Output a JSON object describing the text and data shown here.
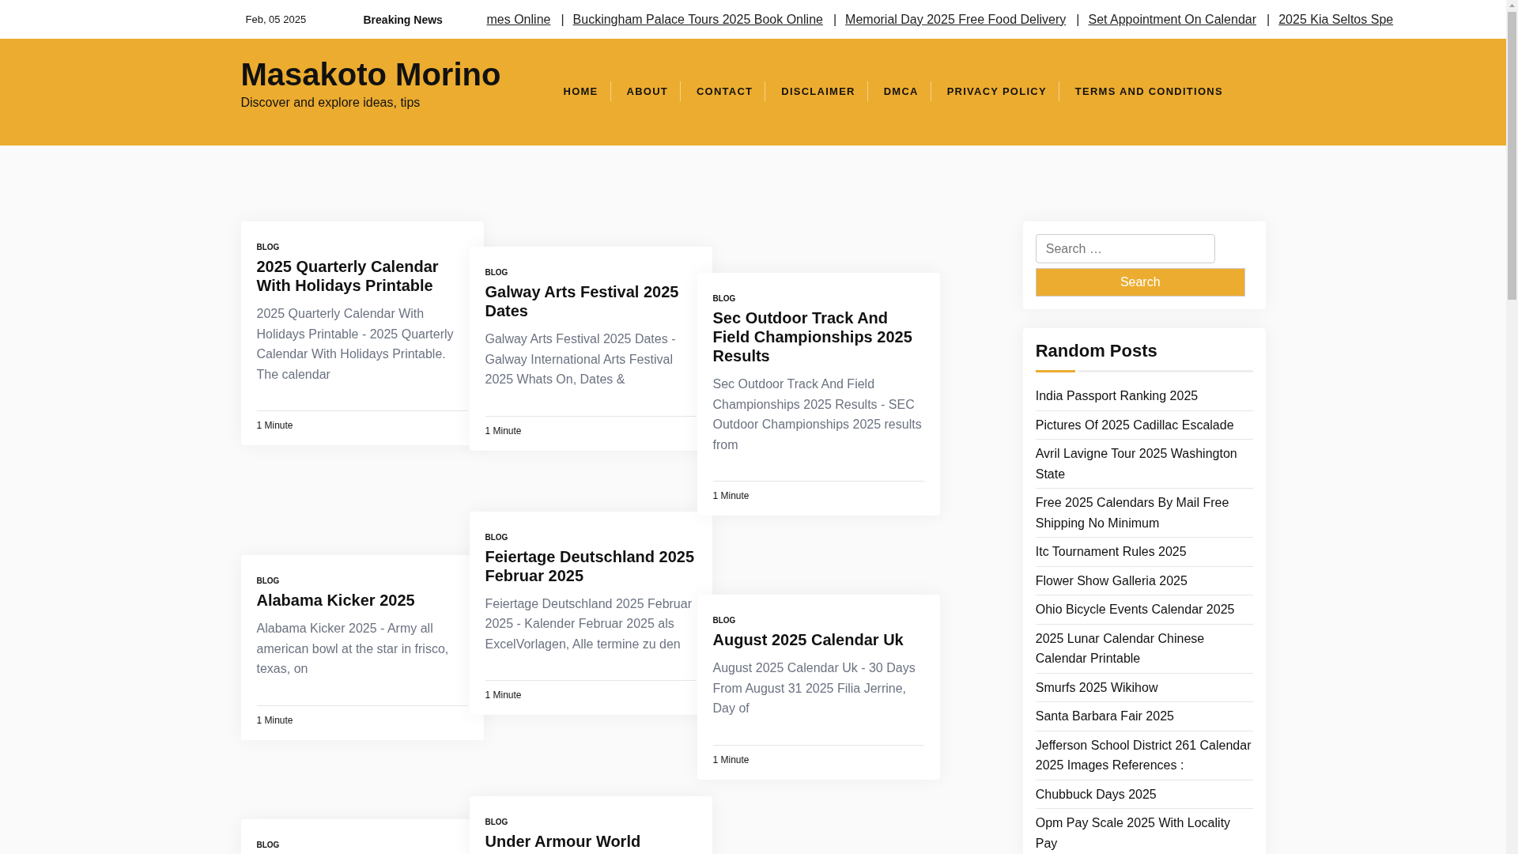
{
  "top_bar": {
    "date": "Feb, 05 2025",
    "breaking_label": "Breaking News",
    "ticker": {
      "separator": "|",
      "items": [
        "mes Online",
        "Buckingham Palace Tours 2025 Book Online",
        "Memorial Day 2025 Free Food Delivery",
        "Set Appointment On Calendar",
        "2025 Kia Seltos Spe"
      ]
    }
  },
  "header": {
    "site_title": "Masakoto Morino",
    "tagline": "Discover and explore ideas, tips",
    "nav": [
      "HOME",
      "ABOUT",
      "CONTACT",
      "DISCLAIMER",
      "DMCA",
      "PRIVACY POLICY",
      "TERMS AND CONDITIONS"
    ]
  },
  "posts": [
    {
      "category": "BLOG",
      "title": "2025 Quarterly Calendar With Holidays Printable",
      "excerpt": "2025 Quarterly Calendar With Holidays Printable - 2025 Quarterly Calendar With Holidays Printable. The calendar",
      "read_time": "1 Minute"
    },
    {
      "category": "BLOG",
      "title": "Galway Arts Festival 2025 Dates",
      "excerpt": "Galway Arts Festival 2025 Dates - Galway International Arts Festival 2025 Whats On, Dates &",
      "read_time": "1 Minute"
    },
    {
      "category": "BLOG",
      "title": "Sec Outdoor Track And Field Championships 2025 Results",
      "excerpt": "Sec Outdoor Track And Field Championships 2025 Results - SEC Outdoor Championships 2025 results from",
      "read_time": "1 Minute"
    },
    {
      "category": "BLOG",
      "title": "Alabama Kicker 2025",
      "excerpt": "Alabama Kicker 2025 - Army all american bowl at the star in frisco, texas, on",
      "read_time": "1 Minute"
    },
    {
      "category": "BLOG",
      "title": "Feiertage Deutschland 2025 Februar 2025",
      "excerpt": "Feiertage Deutschland 2025 Februar 2025 - Kalender Februar 2025 als ExcelVorlagen, Alle termine zu den",
      "read_time": "1 Minute"
    },
    {
      "category": "BLOG",
      "title": "August 2025 Calendar Uk",
      "excerpt": "August 2025 Calendar Uk - 30 Days From August 31 2025 Filia Jerrine, Day of",
      "read_time": "1 Minute"
    },
    {
      "category": "BLOG"
    },
    {
      "category": "BLOG",
      "title": "Under Armour World"
    }
  ],
  "sidebar": {
    "search": {
      "placeholder": "Search …",
      "button": "Search"
    },
    "random_posts": {
      "title": "Random Posts",
      "items": [
        "India Passport Ranking 2025",
        "Pictures Of 2025 Cadillac Escalade",
        "Avril Lavigne Tour 2025 Washington State",
        "Free 2025 Calendars By Mail Free Shipping No Minimum",
        "Itc Tournament Rules 2025",
        "Flower Show Galleria 2025",
        "Ohio Bicycle Events Calendar 2025",
        "2025 Lunar Calendar Chinese Calendar Printable",
        "Smurfs 2025 Wikihow",
        "Santa Barbara Fair 2025",
        "Jefferson School District 261 Calendar 2025 Images References :",
        "Chubbuck Days 2025",
        "Opm Pay Scale 2025 With Locality Pay"
      ]
    }
  }
}
